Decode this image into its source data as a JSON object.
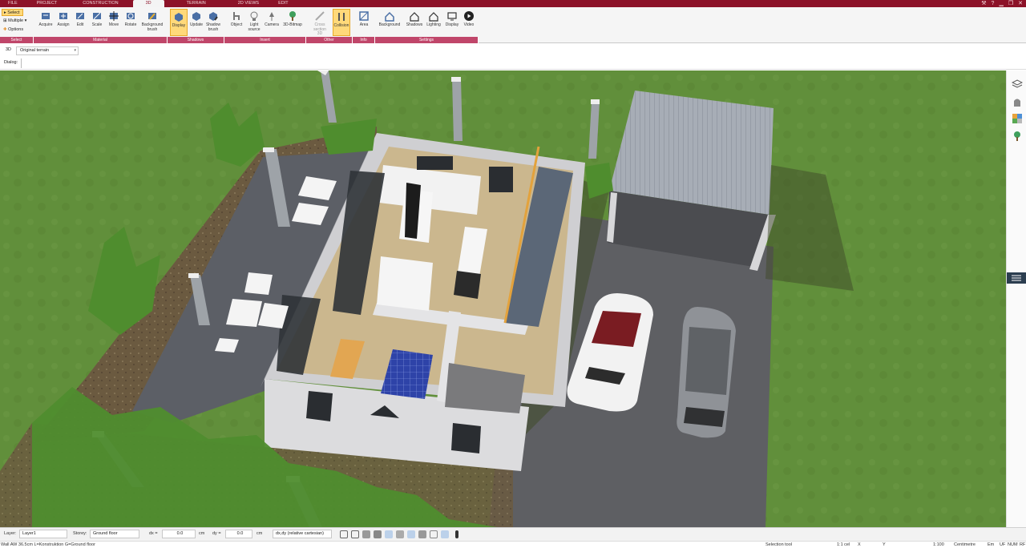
{
  "menu_tabs": [
    "FILE",
    "PROJECT",
    "CONSTRUCTION",
    "3D",
    "TERRAIN",
    "2D VIEWS",
    "EDIT"
  ],
  "active_tab": "3D",
  "ribbon": {
    "select": {
      "select": "Select",
      "multiple": "Multiple",
      "options": "Options",
      "group": "Select"
    },
    "material": {
      "buttons": [
        "Acquire",
        "Assign",
        "Edit",
        "Scale",
        "Move",
        "Rotate",
        "Background brush"
      ],
      "group": "Material"
    },
    "shadows": {
      "buttons": [
        "Display",
        "Update",
        "Shadow brush"
      ],
      "group": "Shadows"
    },
    "insert": {
      "buttons": [
        "Object",
        "Light source",
        "Camera",
        "3D-Bitmap"
      ],
      "group": "Insert"
    },
    "other": {
      "buttons": [
        "Cross section 3D",
        "Collision"
      ],
      "group": "Other"
    },
    "info": {
      "buttons": [
        "Area"
      ],
      "group": "Info"
    },
    "settings": {
      "buttons": [
        "Background",
        "Shadows",
        "Lighting",
        "Display",
        "Video"
      ],
      "group": "Settings"
    }
  },
  "view_bar": {
    "view_mode": "3D",
    "terrain": "Original terrain"
  },
  "dialog": {
    "label": "Dialog:"
  },
  "statusbar": {
    "layer_label": "Layer:",
    "layer_value": "Layer1",
    "storey_label": "Storey:",
    "storey_value": "Ground floor",
    "dx_label": "dx =",
    "dx_value": "0.0",
    "dx_unit": "cm",
    "dy_label": "dy =",
    "dy_value": "0.0",
    "dy_unit": "cm",
    "coord_mode": "dx,dy (relative cartesian)",
    "tool": "Selection tool",
    "scale_ratio": "1:1 cel",
    "x_label": "X",
    "y_label": "Y",
    "scale": "1:100",
    "unit": "Centimetre",
    "lang": "Em",
    "uf": "UF",
    "num": "NUM",
    "rf": "RF"
  },
  "status_info": "Wall AW 36.5cm L=Konstruktion G=Ground floor",
  "colors": {
    "accent": "#8c1228",
    "ribbon_group": "#c0466a",
    "active_button": "#ffd97a",
    "grass": "#5f8f3a"
  }
}
